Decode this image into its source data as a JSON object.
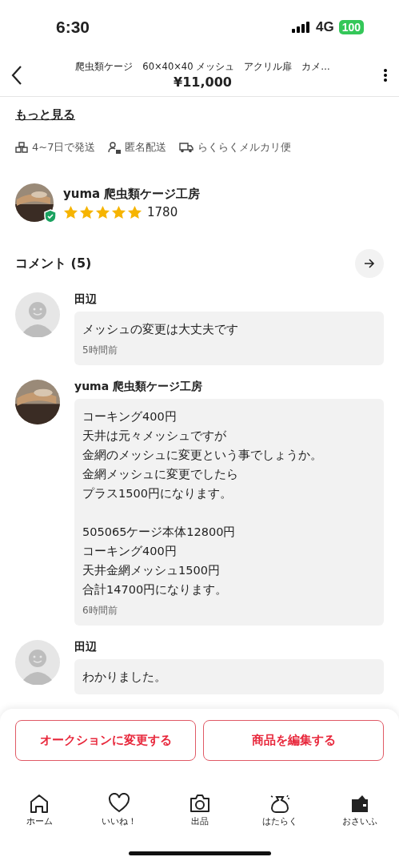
{
  "status_bar": {
    "time": "6:30",
    "network": "4G",
    "battery": "100"
  },
  "header": {
    "title": "爬虫類ケージ　60×40×40 メッシュ　アクリル扉　カメ…",
    "price": "¥11,000"
  },
  "more_link": "もっと見る",
  "shipping": [
    {
      "kind": "days",
      "label": "4~7日で発送"
    },
    {
      "kind": "anonymous",
      "label": "匿名配送"
    },
    {
      "kind": "truck",
      "label": "らくらくメルカリ便"
    }
  ],
  "seller": {
    "name": "yuma 爬虫類ケージ工房",
    "stars": 5,
    "rating_count": "1780",
    "verified": true
  },
  "comments_section": {
    "title": "コメント (5)"
  },
  "comments": [
    {
      "kind": "buyer",
      "name": "田辺",
      "paragraphs": [
        [
          "メッシュの変更は大丈夫です"
        ]
      ],
      "time": "5時間前"
    },
    {
      "kind": "seller",
      "name": "yuma 爬虫類ケージ工房",
      "paragraphs": [
        [
          "コーキング400円",
          "天井は元々メッシュですが",
          "金網のメッシュに変更という事でしょうか。",
          "金網メッシュに変更でしたら",
          "プラス1500円になります。"
        ],
        [
          "505065ケージ本体12800円",
          "コーキング400円",
          "天井金網メッシュ1500円",
          "合計14700円になります。"
        ]
      ],
      "time": "6時間前"
    },
    {
      "kind": "buyer",
      "name": "田辺",
      "paragraphs": [
        [
          "わかりました。"
        ]
      ]
    }
  ],
  "actions": [
    "オークションに変更する",
    "商品を編集する"
  ],
  "nav": [
    {
      "kind": "home",
      "label": "ホーム"
    },
    {
      "kind": "heart",
      "label": "いいね！"
    },
    {
      "kind": "camera",
      "label": "出品"
    },
    {
      "kind": "bag",
      "label": "はたらく"
    },
    {
      "kind": "wallet",
      "label": "おさいふ"
    }
  ]
}
